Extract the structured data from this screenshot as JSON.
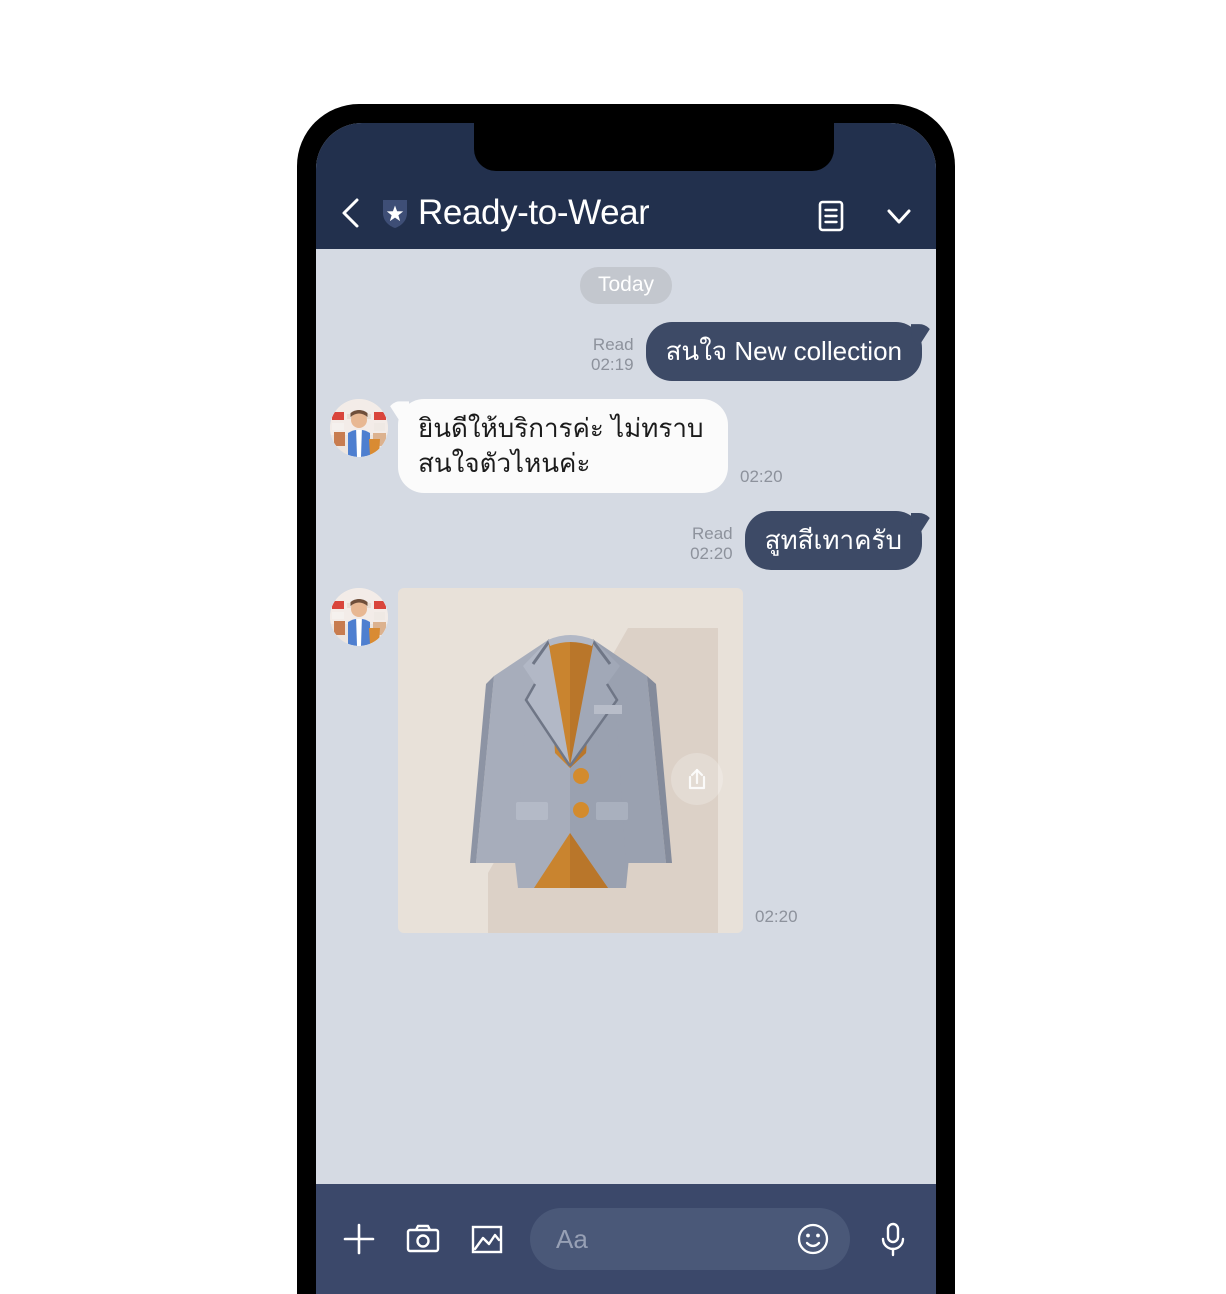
{
  "app": {
    "screen_name": "line-chat-conversation"
  },
  "header": {
    "back_icon": "chevron-left-icon",
    "badge_icon": "shield-star-icon",
    "title": "Ready-to-Wear",
    "menu_icon": "document-list-icon",
    "collapse_icon": "chevron-down-icon",
    "background": "#22304d",
    "text_color": "#ffffff"
  },
  "chat": {
    "background": "#d5dae3",
    "day_divider": "Today",
    "messages": [
      {
        "id": "msg-1",
        "direction": "outgoing",
        "type": "text",
        "text": "สนใจ New collection",
        "read_label": "Read",
        "time": "02:19",
        "bubble_color": "#3d4a66"
      },
      {
        "id": "msg-2",
        "direction": "incoming",
        "type": "text",
        "text": "ยินดีให้บริการค่ะ ไม่ทราบสนใจตัวไหนค่ะ",
        "time": "02:20",
        "bubble_color": "#fbfbfb",
        "avatar": "shop-assistant-avatar"
      },
      {
        "id": "msg-3",
        "direction": "outgoing",
        "type": "text",
        "text": "สูทสีเทาครับ",
        "read_label": "Read",
        "time": "02:20",
        "bubble_color": "#3d4a66"
      },
      {
        "id": "msg-4",
        "direction": "incoming",
        "type": "image",
        "image_subject": "gray-suit-jacket-illustration",
        "image_background": "#e8e1d9",
        "time": "02:20",
        "share_icon": "share-upload-icon",
        "avatar": "shop-assistant-avatar"
      }
    ]
  },
  "toolbar": {
    "background": "#3b486a",
    "add_icon": "plus-icon",
    "camera_icon": "camera-icon",
    "gallery_icon": "photo-gallery-icon",
    "input_placeholder": "Aa",
    "emoji_icon": "smiley-face-icon",
    "mic_icon": "microphone-icon"
  },
  "colors": {
    "accent_navy": "#22304d",
    "bubble_out": "#3d4a66",
    "bubble_in": "#fbfbfb",
    "chat_bg": "#d5dae3",
    "suit_gray": "#9aa1b0",
    "suit_shirt_orange": "#c9842f"
  }
}
